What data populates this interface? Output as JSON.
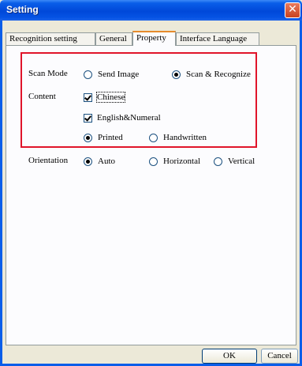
{
  "window": {
    "title": "Setting",
    "close_glyph": "✕"
  },
  "tabs": [
    {
      "label": "Recognition setting",
      "active": false
    },
    {
      "label": "General",
      "active": false
    },
    {
      "label": "Property",
      "active": true
    },
    {
      "label": "Interface Language",
      "active": false
    }
  ],
  "scan_mode": {
    "label": "Scan Mode",
    "options": [
      {
        "label": "Send Image",
        "selected": false
      },
      {
        "label": "Scan & Recognize",
        "selected": true
      }
    ]
  },
  "content": {
    "label": "Content",
    "checkboxes": [
      {
        "label": "Chinese",
        "checked": true
      },
      {
        "label": "English&Numeral",
        "checked": true
      }
    ],
    "type_options": [
      {
        "label": "Printed",
        "selected": true
      },
      {
        "label": "Handwritten",
        "selected": false
      }
    ]
  },
  "orientation": {
    "label": "Orientation",
    "options": [
      {
        "label": "Auto",
        "selected": true
      },
      {
        "label": "Horizontal",
        "selected": false
      },
      {
        "label": "Vertical",
        "selected": false
      }
    ]
  },
  "buttons": {
    "ok": "OK",
    "cancel": "Cancel"
  },
  "colors": {
    "highlight": "#e0142a",
    "titlebar": "#0048d9",
    "close": "#c9421e"
  }
}
